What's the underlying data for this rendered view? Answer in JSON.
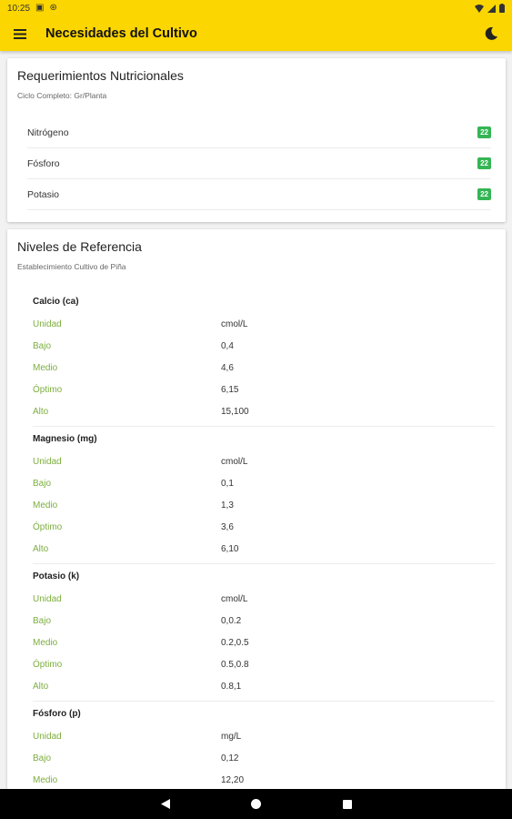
{
  "status_bar": {
    "time": "10:25"
  },
  "app_bar": {
    "title": "Necesidades del Cultivo"
  },
  "nutrients_card": {
    "title": "Requerimientos Nutricionales",
    "subtitle": "Ciclo Completo: Gr/Planta",
    "items": [
      {
        "label": "Nitrógeno",
        "badge": "22"
      },
      {
        "label": "Fósforo",
        "badge": "22"
      },
      {
        "label": "Potasio",
        "badge": "22"
      }
    ]
  },
  "reference_card": {
    "title": "Niveles de Referencia",
    "subtitle": "Establecimiento Cultivo de Piña",
    "sections": [
      {
        "name": "Calcio (ca)",
        "rows": [
          {
            "label": "Unidad",
            "value": "cmol/L"
          },
          {
            "label": "Bajo",
            "value": "0,4"
          },
          {
            "label": "Medio",
            "value": "4,6"
          },
          {
            "label": "Óptimo",
            "value": "6,15"
          },
          {
            "label": "Alto",
            "value": "15,100"
          }
        ]
      },
      {
        "name": "Magnesio (mg)",
        "rows": [
          {
            "label": "Unidad",
            "value": "cmol/L"
          },
          {
            "label": "Bajo",
            "value": "0,1"
          },
          {
            "label": "Medio",
            "value": "1,3"
          },
          {
            "label": "Óptimo",
            "value": "3,6"
          },
          {
            "label": "Alto",
            "value": "6,10"
          }
        ]
      },
      {
        "name": "Potasio (k)",
        "rows": [
          {
            "label": "Unidad",
            "value": "cmol/L"
          },
          {
            "label": "Bajo",
            "value": "0,0.2"
          },
          {
            "label": "Medio",
            "value": "0.2,0.5"
          },
          {
            "label": "Óptimo",
            "value": "0.5,0.8"
          },
          {
            "label": "Alto",
            "value": "0.8,1"
          }
        ]
      },
      {
        "name": "Fósforo (p)",
        "rows": [
          {
            "label": "Unidad",
            "value": "mg/L"
          },
          {
            "label": "Bajo",
            "value": "0,12"
          },
          {
            "label": "Medio",
            "value": "12,20"
          }
        ]
      }
    ]
  },
  "colors": {
    "accent": "#fcd600",
    "label_green": "#7cae3e",
    "badge_green": "#35b554"
  },
  "icons": {
    "menu": "menu-icon",
    "theme": "moon-icon",
    "back": "back-triangle-icon",
    "home": "home-circle-icon",
    "recents": "recents-square-icon"
  }
}
